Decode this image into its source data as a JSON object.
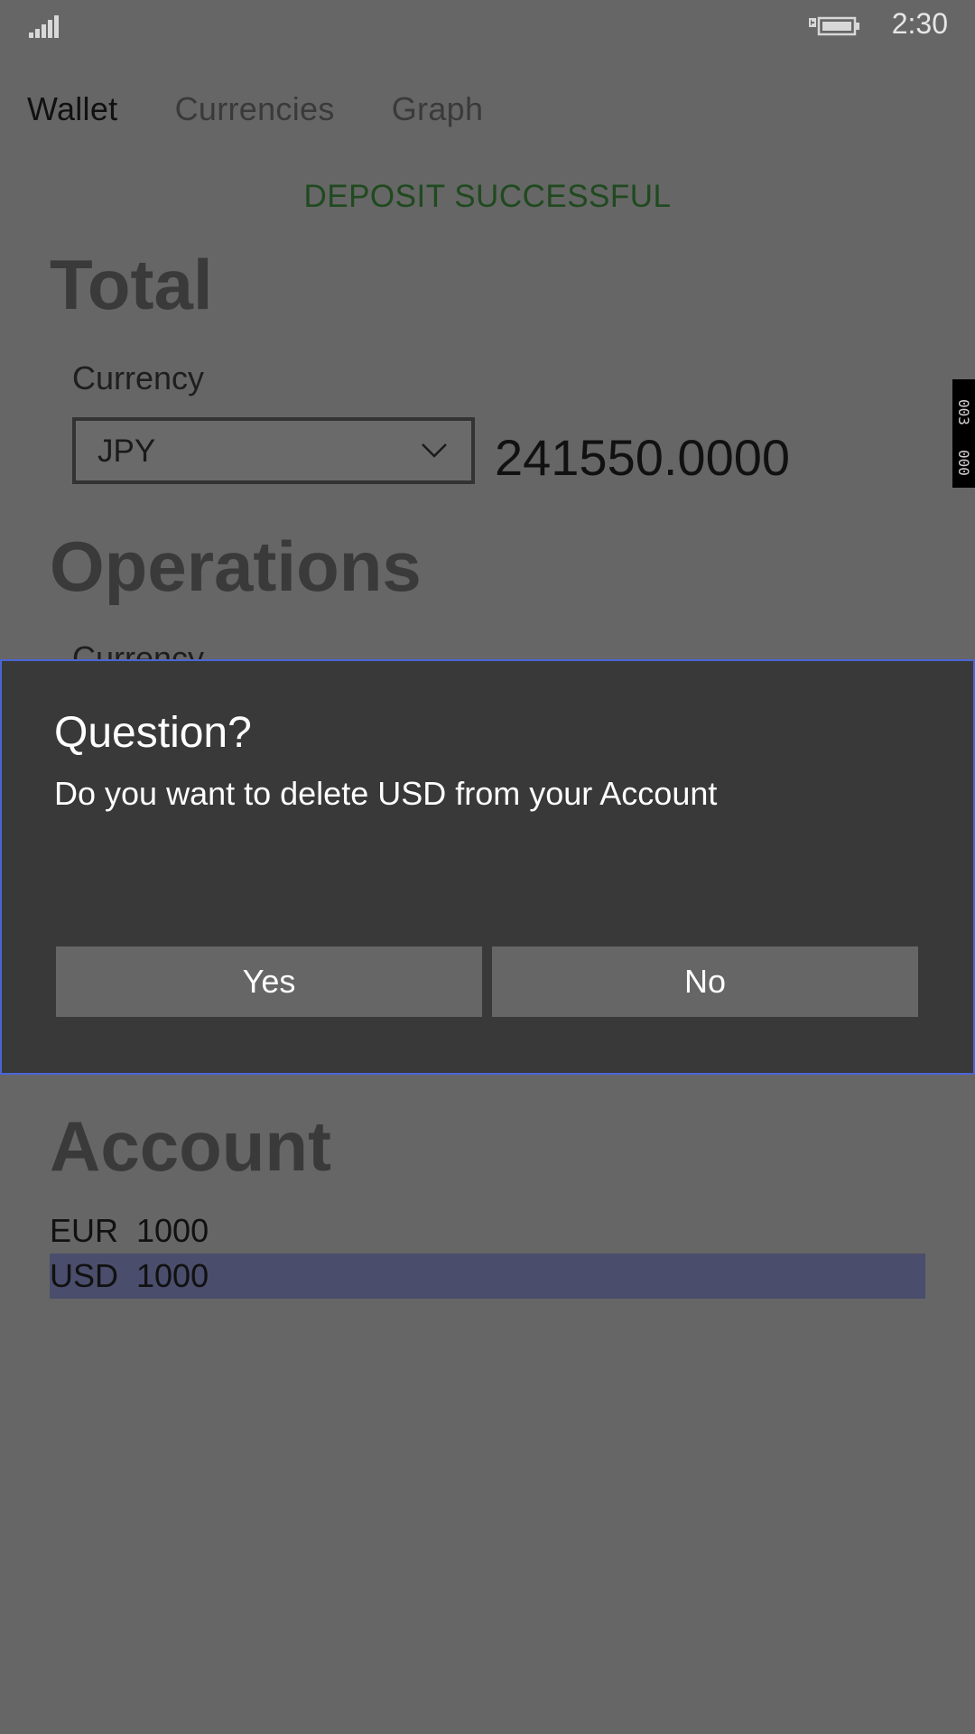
{
  "status_bar": {
    "signal_icon": "signal-bars-icon",
    "battery_icon": "battery-charging-icon",
    "time": "2:30"
  },
  "tabs": [
    {
      "label": "Wallet",
      "active": true
    },
    {
      "label": "Currencies",
      "active": false
    },
    {
      "label": "Graph",
      "active": false
    }
  ],
  "notification": {
    "text": "DEPOSIT SUCCESSFUL",
    "color": "#1f4a1f"
  },
  "total": {
    "heading": "Total",
    "currency_label": "Currency",
    "selected_currency": "JPY",
    "amount": "241550.0000"
  },
  "side_counter": {
    "top": "003",
    "bottom": "000"
  },
  "operations": {
    "heading": "Operations",
    "currency_label": "Currency"
  },
  "dialog": {
    "title": "Question?",
    "message": "Do you want to delete USD from your Account",
    "yes_label": "Yes",
    "no_label": "No",
    "border_color": "#4a66d6"
  },
  "account": {
    "heading": "Account",
    "items": [
      {
        "label": "EUR  1000",
        "selected": false
      },
      {
        "label": "USD  1000",
        "selected": true
      }
    ],
    "selection_color": "#4a4d6b"
  }
}
